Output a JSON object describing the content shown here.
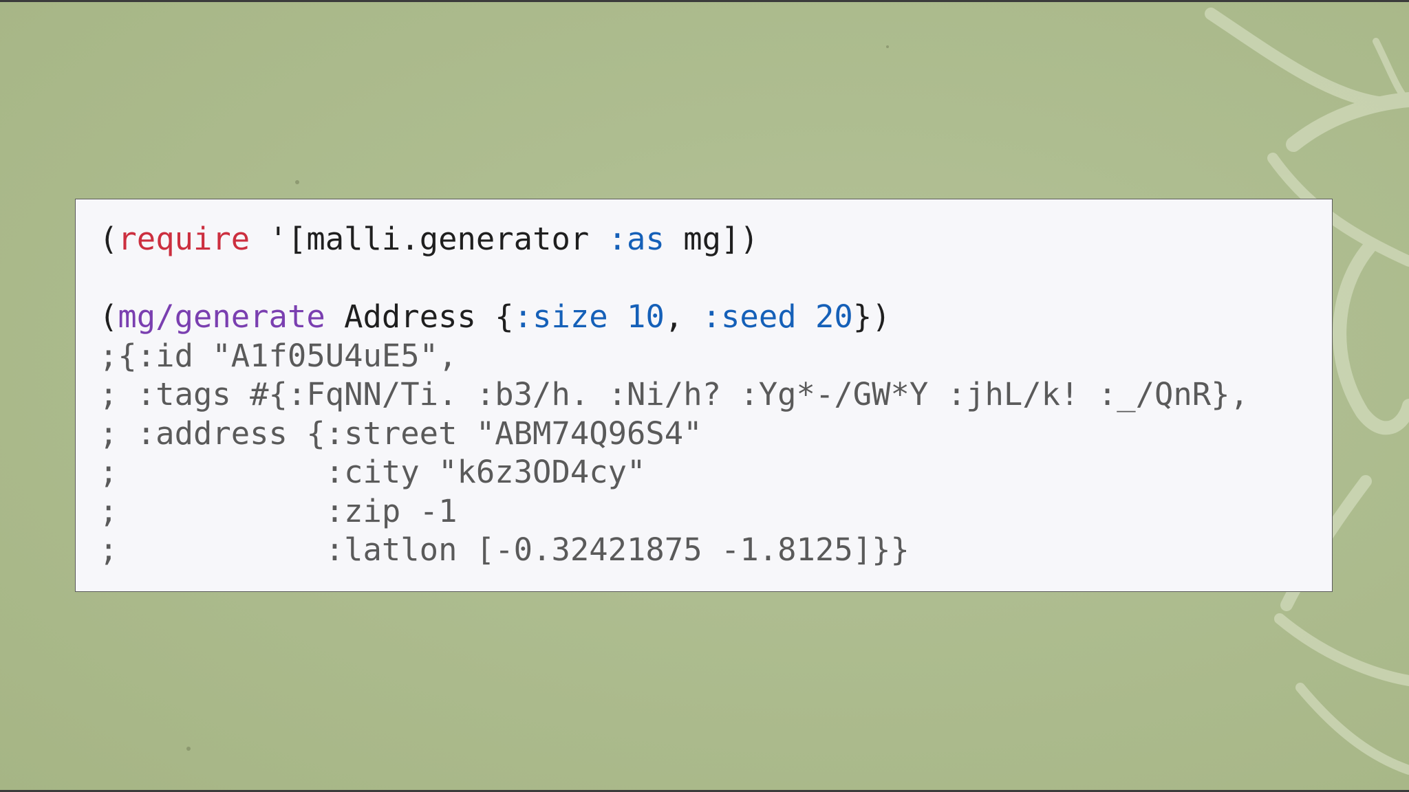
{
  "code": {
    "line1": {
      "open": "(",
      "require": "require",
      "mid": " '[malli.generator ",
      "as": ":as",
      "end": " mg])"
    },
    "line3": {
      "open": "(",
      "fn": "mg/generate",
      "mid": " Address {",
      "size_kw": ":size",
      "sp1": " ",
      "size_val": "10",
      "comma": ", ",
      "seed_kw": ":seed",
      "sp2": " ",
      "seed_val": "20",
      "end": "})"
    },
    "comments": [
      ";{:id \"A1f05U4uE5\",",
      "; :tags #{:FqNN/Ti. :b3/h. :Ni/h? :Yg*-/GW*Y :jhL/k! :_/QnR},",
      "; :address {:street \"ABM74Q96S4\"",
      ";           :city \"k6z3OD4cy\"",
      ";           :zip -1",
      ";           :latlon [-0.32421875 -1.8125]}}"
    ]
  },
  "colors": {
    "background": "#aebd90",
    "panel": "#f7f7fa",
    "special_form": "#cc2f3f",
    "function": "#7a3fb0",
    "keyword": "#1560b8",
    "comment": "#5a5a5a"
  }
}
